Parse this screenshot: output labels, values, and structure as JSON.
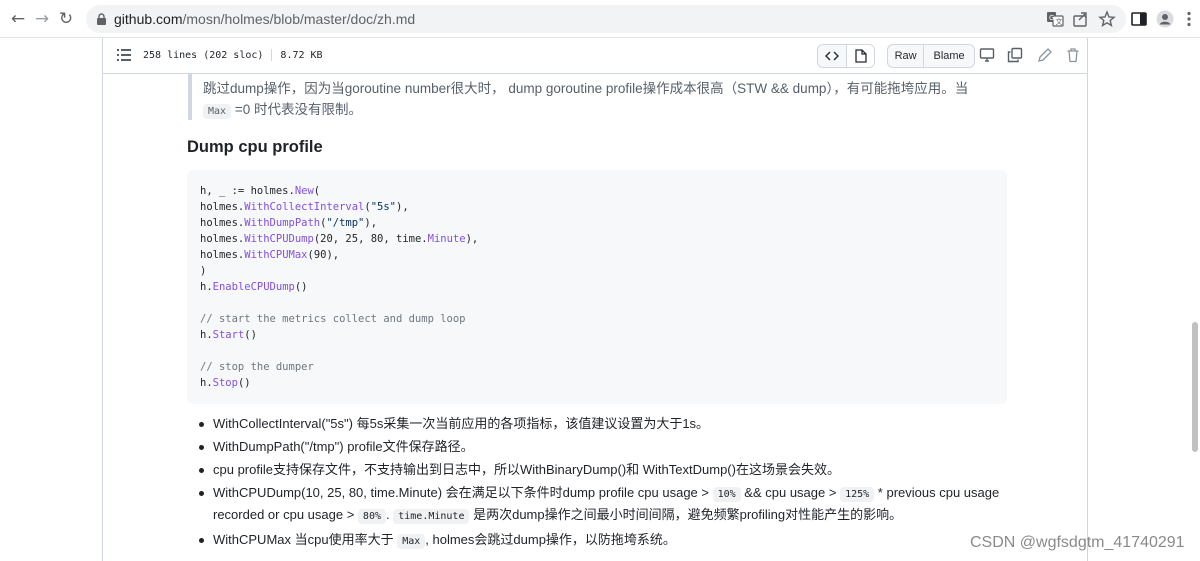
{
  "browser": {
    "url_host": "github.com",
    "url_path": "/mosn/holmes/blob/master/doc/zh.md",
    "back_glyph": "←",
    "forward_glyph": "→",
    "reload_glyph": "↻",
    "icons": [
      "translate-icon",
      "share-icon",
      "bookmark-star-icon",
      "side-panel-icon",
      "profile-icon",
      "menu-icon"
    ]
  },
  "file_header": {
    "lines": "258 lines (202 sloc)",
    "size": "8.72 KB",
    "raw_label": "Raw",
    "blame_label": "Blame"
  },
  "quote": {
    "line1": "跳过dump操作，因为当goroutine number很大时， dump goroutine profile操作成本很高（STW && dump），有可能拖垮应用。当",
    "code": "Max",
    "line2": "=0 时代表没有限制。"
  },
  "heading": "Dump cpu profile",
  "code": {
    "l1a": "h, _ := holmes.",
    "l1fn": "New",
    "l1b": "(",
    "l2a": "holmes.",
    "l2fn": "WithCollectInterval",
    "l2b": "(",
    "l2s": "\"5s\"",
    "l2c": "),",
    "l3a": "holmes.",
    "l3fn": "WithDumpPath",
    "l3b": "(",
    "l3s": "\"/tmp\"",
    "l3c": "),",
    "l4a": "holmes.",
    "l4fn": "WithCPUDump",
    "l4b": "(",
    "l4n": "20, 25, 80",
    "l4c": ", time.",
    "l4fn2": "Minute",
    "l4d": "),",
    "l5a": "holmes.",
    "l5fn": "WithCPUMax",
    "l5b": "(",
    "l5n": "90",
    "l5c": "),",
    "l6": ")",
    "l7a": "h.",
    "l7fn": "EnableCPUDump",
    "l7b": "()",
    "c1": "// start the metrics collect and dump loop",
    "l8a": "h.",
    "l8fn": "Start",
    "l8b": "()",
    "c2": "// stop the dumper",
    "l9a": "h.",
    "l9fn": "Stop",
    "l9b": "()"
  },
  "bullets": {
    "b1": "WithCollectInterval(\"5s\") 每5s采集一次当前应用的各项指标，该值建议设置为大于1s。",
    "b2": "WithDumpPath(\"/tmp\") profile文件保存路径。",
    "b3": "cpu profile支持保存文件，不支持输出到日志中，所以WithBinaryDump()和 WithTextDump()在这场景会失效。",
    "b4a": "WithCPUDump(10, 25, 80, time.Minute) 会在满足以下条件时dump profile cpu usage >",
    "b4c1": "10%",
    "b4b": "&& cpu usage >",
    "b4c2": "125%",
    "b4c": "* previous cpu usage recorded or cpu usage >",
    "b4c3": "80%",
    "b4d": ".",
    "b4c4": "time.Minute",
    "b4e": "是两次dump操作之间最小时间间隔，避免频繁profiling对性能产生的影响。",
    "b5a": "WithCPUMax 当cpu使用率大于",
    "b5c": "Max",
    "b5b": ", holmes会跳过dump操作，以防拖垮系统。"
  },
  "watermark": "CSDN @wgfsdgtm_41740291",
  "colors": {
    "border": "#d0d7de",
    "code_bg": "#f6f8fa",
    "function": "#8250df",
    "string": "#0a3069",
    "comment": "#6e7781"
  }
}
